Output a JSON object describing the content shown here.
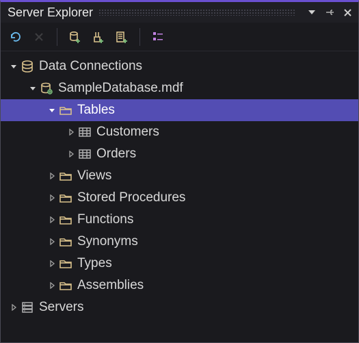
{
  "panel": {
    "title": "Server Explorer"
  },
  "toolbar": {
    "refresh": "Refresh",
    "stop": "Stop",
    "connectDb": "Connect to Database",
    "connectSrv": "Connect to Server",
    "addService": "Add Service",
    "sortCategory": "Sort by Category"
  },
  "tree": {
    "dataConnections": {
      "label": "Data Connections",
      "expanded": true,
      "children": {
        "db": {
          "label": "SampleDatabase.mdf",
          "expanded": true,
          "children": {
            "tables": {
              "label": "Tables",
              "expanded": true,
              "selected": true,
              "children": {
                "customers": {
                  "label": "Customers"
                },
                "orders": {
                  "label": "Orders"
                }
              }
            },
            "views": {
              "label": "Views"
            },
            "sprocs": {
              "label": "Stored Procedures"
            },
            "functions": {
              "label": "Functions"
            },
            "synonyms": {
              "label": "Synonyms"
            },
            "types": {
              "label": "Types"
            },
            "assemblies": {
              "label": "Assemblies"
            }
          }
        }
      }
    },
    "servers": {
      "label": "Servers",
      "expanded": false
    }
  }
}
